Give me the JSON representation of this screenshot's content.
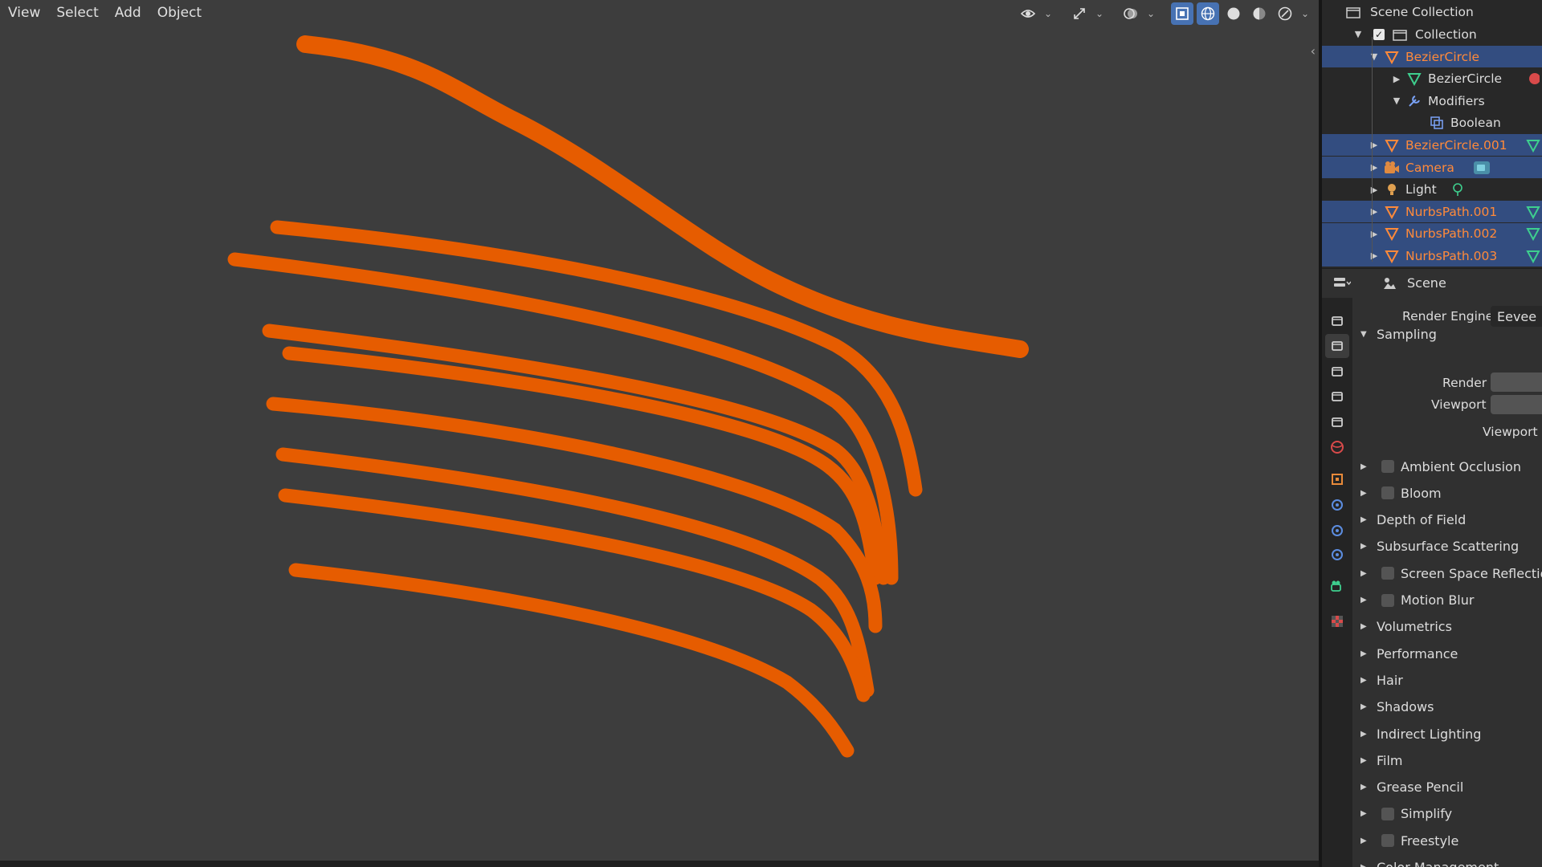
{
  "viewport": {
    "menu": [
      "View",
      "Select",
      "Add",
      "Object"
    ],
    "curve_color": "#e65c00",
    "background_color": "#3d3d3d",
    "toolbar_icons": [
      "visibility-icon",
      "gizmo-icon",
      "overlay-icon",
      "xray-icon",
      "wireframe-shading-icon",
      "solid-shading-icon",
      "material-shading-icon",
      "rendered-shading-icon"
    ]
  },
  "outliner": {
    "scene_collection": "Scene Collection",
    "collection": "Collection",
    "items": [
      {
        "label": "BezierCircle",
        "type": "curve",
        "selected": true,
        "orange": true
      },
      {
        "label": "BezierCircle",
        "type": "curve-data",
        "selected": false,
        "orange": false
      },
      {
        "label": "Modifiers",
        "type": "modifiers",
        "selected": false,
        "orange": false
      },
      {
        "label": "Boolean",
        "type": "boolean-modifier",
        "selected": false,
        "orange": false
      },
      {
        "label": "BezierCircle.001",
        "type": "curve",
        "selected": true,
        "orange": true
      },
      {
        "label": "Camera",
        "type": "camera",
        "selected": true,
        "orange": true
      },
      {
        "label": "Light",
        "type": "light",
        "selected": false,
        "orange": false
      },
      {
        "label": "NurbsPath.001",
        "type": "curve",
        "selected": true,
        "orange": true
      },
      {
        "label": "NurbsPath.002",
        "type": "curve",
        "selected": true,
        "orange": true
      },
      {
        "label": "NurbsPath.003",
        "type": "curve",
        "selected": true,
        "orange": true
      }
    ]
  },
  "properties": {
    "context": "Scene",
    "render_engine_label": "Render Engine",
    "render_engine_value": "Eevee",
    "sampling_label": "Sampling",
    "render_label": "Render",
    "viewport_label": "Viewport",
    "viewport_denoise_label": "Viewport D",
    "panels": [
      {
        "label": "Ambient Occlusion",
        "checkbox": true
      },
      {
        "label": "Bloom",
        "checkbox": true
      },
      {
        "label": "Depth of Field",
        "checkbox": false
      },
      {
        "label": "Subsurface Scattering",
        "checkbox": false
      },
      {
        "label": "Screen Space Reflectio",
        "checkbox": true
      },
      {
        "label": "Motion Blur",
        "checkbox": true
      },
      {
        "label": "Volumetrics",
        "checkbox": false
      },
      {
        "label": "Performance",
        "checkbox": false
      },
      {
        "label": "Hair",
        "checkbox": false
      },
      {
        "label": "Shadows",
        "checkbox": false
      },
      {
        "label": "Indirect Lighting",
        "checkbox": false
      },
      {
        "label": "Film",
        "checkbox": false
      },
      {
        "label": "Grease Pencil",
        "checkbox": false
      },
      {
        "label": "Simplify",
        "checkbox": true
      },
      {
        "label": "Freestyle",
        "checkbox": true
      },
      {
        "label": "Color Management",
        "checkbox": false
      }
    ],
    "tabs": [
      "tool-icon",
      "render-icon",
      "output-icon",
      "view-layer-icon",
      "scene-icon",
      "world-icon",
      "object-icon",
      "modifier-icon",
      "physics-icon",
      "constraint-icon",
      "data-icon",
      "texture-icon"
    ]
  }
}
